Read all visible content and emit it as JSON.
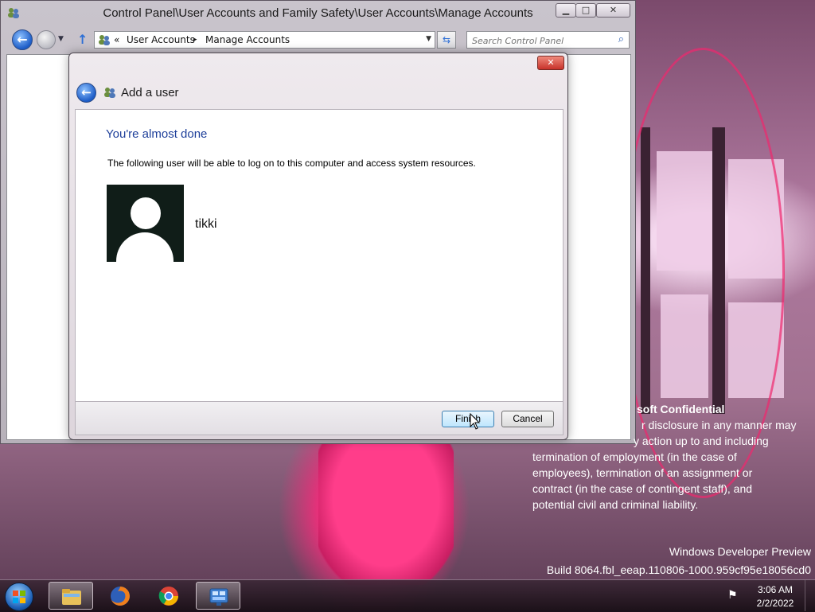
{
  "explorer": {
    "title": "Control Panel\\User Accounts and Family Safety\\User Accounts\\Manage Accounts",
    "window_controls": {
      "minimize": "▁",
      "maximize": "□",
      "close": "✕"
    },
    "breadcrumb": {
      "chevron": "«",
      "segments": [
        "User Accounts",
        "Manage Accounts"
      ],
      "separator": "▸"
    },
    "search_placeholder": "Search Control Panel"
  },
  "dialog": {
    "heading": "Add a user",
    "title": "You're almost done",
    "description": "The following user will be able to log on to this computer and access system resources.",
    "username": "tikki",
    "buttons": {
      "finish": "Finish",
      "cancel": "Cancel"
    },
    "close": "✕"
  },
  "desktop": {
    "confidential_title": "soft Confidential",
    "confidential_lines": [
      "r disclosure in any manner may",
      "y action up to and including",
      "termination of employment (in the case of",
      "employees), termination of an assignment or",
      "contract (in the case of contingent staff), and",
      "potential civil and criminal liability."
    ],
    "build_line1": "Windows Developer Preview",
    "build_line2": "Build 8064.fbl_eeap.110806-1000.959cf95e18056cd0"
  },
  "taskbar": {
    "pinned": [
      "windows-explorer",
      "firefox",
      "chrome",
      "control-panel"
    ],
    "time": "3:06 AM",
    "date": "2/2/2022"
  },
  "colors": {
    "dialog_title": "#1e3f9a",
    "avatar_bg": "#101d18",
    "finish_border": "#3c7fb1"
  }
}
